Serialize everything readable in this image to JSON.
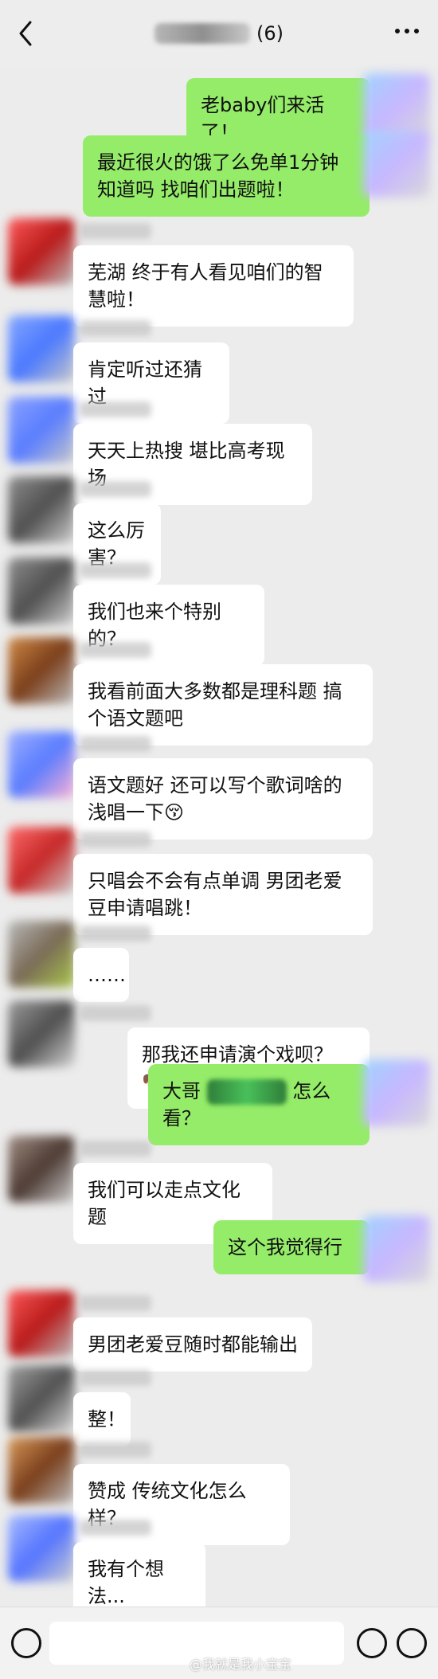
{
  "header": {
    "title_count": "(6)"
  },
  "messages": [
    {
      "side": "out",
      "text": "老baby们来活了！"
    },
    {
      "side": "out",
      "text": "最近很火的饿了么免单1分钟知道吗 找咱们出题啦！"
    },
    {
      "side": "in",
      "text": "芜湖 终于有人看见咱们的智慧啦！"
    },
    {
      "side": "in",
      "text": "肯定听过还猜过"
    },
    {
      "side": "in",
      "text": "天天上热搜 堪比高考现场"
    },
    {
      "side": "in",
      "text": "这么厉害？"
    },
    {
      "side": "in",
      "text": "我们也来个特别的？"
    },
    {
      "side": "in",
      "text": "我看前面大多数都是理科题 搞个语文题吧"
    },
    {
      "side": "in",
      "text": "语文题好 还可以写个歌词啥的浅唱一下😚"
    },
    {
      "side": "in",
      "text": "只唱会不会有点单调 男团老爱豆申请唱跳！"
    },
    {
      "side": "in",
      "text": "……"
    },
    {
      "side": "in",
      "text": "那我还申请演个戏呗？🐶"
    },
    {
      "side": "out",
      "text_prefix": "大哥",
      "text_suffix": "怎么看？"
    },
    {
      "side": "in",
      "text": "我们可以走点文化题"
    },
    {
      "side": "out",
      "text": "这个我觉得行"
    },
    {
      "side": "in",
      "text": "男团老爱豆随时都能输出"
    },
    {
      "side": "in",
      "text": "整！"
    },
    {
      "side": "in",
      "text": "赞成 传统文化怎么样？"
    },
    {
      "side": "in",
      "text": "我有个想法..."
    }
  ],
  "footer": {
    "watermark": "@我就是我小宝宝"
  },
  "colors": {
    "out_bubble": "#95ec69",
    "in_bubble": "#ffffff",
    "bg": "#ececec"
  },
  "icons": [
    "back-arrow-icon",
    "more-dots-icon",
    "voice-icon",
    "emoji-icon",
    "plus-icon"
  ]
}
